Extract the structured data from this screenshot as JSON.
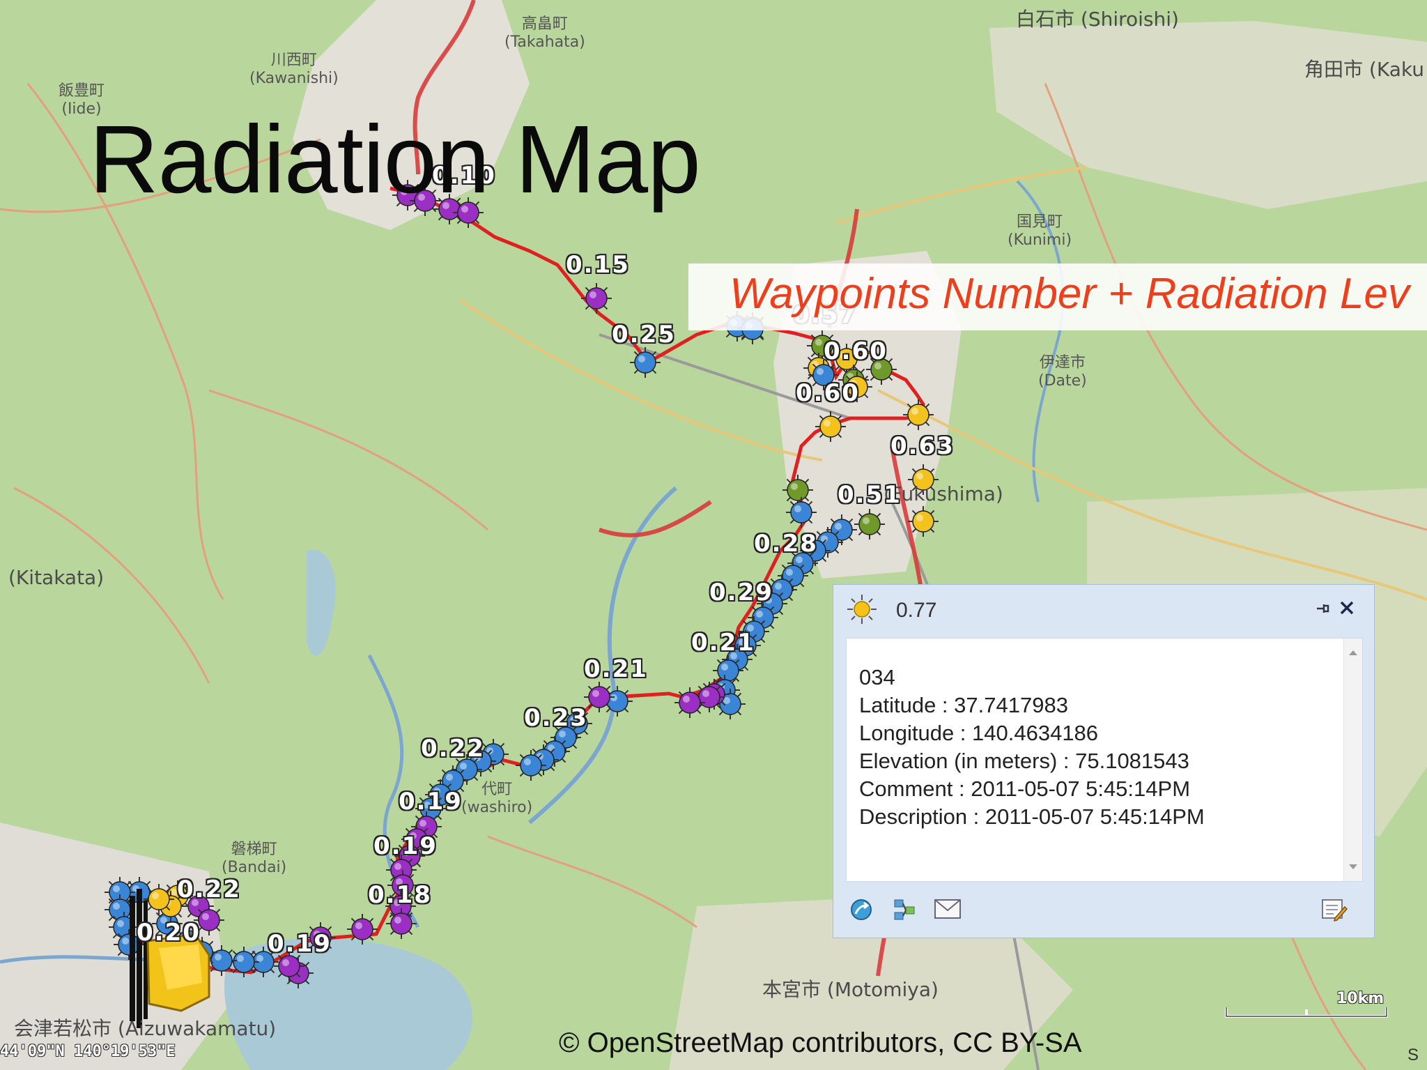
{
  "title": "Radiation Map",
  "banner": "Waypoints Number  +  Radiation Lev",
  "waypoint_labels": [
    "0.10",
    "0.15",
    "0.25",
    "0.57",
    "0.60",
    "0.60",
    "0.63",
    "0.51",
    "0.28",
    "0.29",
    "0.21",
    "0.21",
    "0.23",
    "0.22",
    "0.19",
    "0.19",
    "0.18",
    "0.22",
    "0.20",
    "0.19"
  ],
  "place_names": [
    "高畠町\n(Takahata)",
    "川西町\n(Kawanishi)",
    "飯豊町\n(Iide)",
    "白石市 (Shiroishi)",
    "角田市 (Kaku",
    "国見町\n(Kunimi)",
    "伊達市\n(Date)",
    "(Kitakata)",
    "(Fukushima)",
    "代町\n(washiro)",
    "磐梯町\n(Bandai)",
    "会津若松市 (Aizuwakamatu)",
    "本宮市 (Motomiya)"
  ],
  "popup": {
    "title": "0.77",
    "lines": [
      "034",
      "Latitude : 37.7417983",
      "Longitude : 140.4634186",
      "Elevation (in meters) : 75.1081543",
      "Comment : 2011-05-07 5:45:14PM",
      "Description : 2011-05-07 5:45:14PM"
    ],
    "icons": [
      "sun-icon",
      "pin-icon",
      "close-icon",
      "scroll-up-icon",
      "scroll-down-icon",
      "go-to-icon",
      "share-icon",
      "email-icon",
      "edit-note-icon"
    ]
  },
  "status": {
    "coordinates": "44'09\"N  140°19'53\"E",
    "attribution": "© OpenStreetMap contributors, CC BY-SA",
    "scale": "10km",
    "corner": "S"
  },
  "colors": {
    "route": "#e02020",
    "dose_purple": "#9b2fc4",
    "dose_blue": "#3a85d6",
    "dose_green": "#6f9a2a",
    "dose_yellow": "#f3c21c",
    "banner_text": "#ee3f1c"
  }
}
